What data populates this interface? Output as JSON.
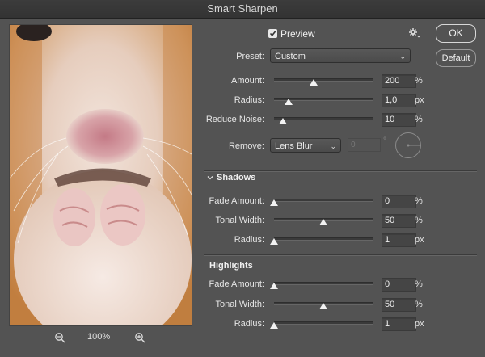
{
  "window": {
    "title": "Smart Sharpen"
  },
  "preview_panel": {
    "zoom_level": "100%"
  },
  "preview": {
    "label": "Preview",
    "checked": true
  },
  "buttons": {
    "ok": "OK",
    "default": "Default"
  },
  "preset": {
    "label": "Preset:",
    "value": "Custom"
  },
  "main_sliders": [
    {
      "label": "Amount:",
      "value": "200",
      "unit": "%",
      "level": 0.4
    },
    {
      "label": "Radius:",
      "value": "1,0",
      "unit": "px",
      "level": 0.15
    },
    {
      "label": "Reduce Noise:",
      "value": "10",
      "unit": "%",
      "level": 0.09
    }
  ],
  "remove": {
    "label": "Remove:",
    "value": "Lens Blur",
    "angle_value": "0",
    "angle_unit": "°"
  },
  "shadows": {
    "title": "Shadows",
    "sliders": [
      {
        "label": "Fade Amount:",
        "value": "0",
        "unit": "%",
        "level": 0
      },
      {
        "label": "Tonal Width:",
        "value": "50",
        "unit": "%",
        "level": 0.5
      },
      {
        "label": "Radius:",
        "value": "1",
        "unit": "px",
        "level": 0
      }
    ]
  },
  "highlights": {
    "title": "Highlights",
    "sliders": [
      {
        "label": "Fade Amount:",
        "value": "0",
        "unit": "%",
        "level": 0
      },
      {
        "label": "Tonal Width:",
        "value": "50",
        "unit": "%",
        "level": 0.5
      },
      {
        "label": "Radius:",
        "value": "1",
        "unit": "px",
        "level": 0
      }
    ]
  }
}
